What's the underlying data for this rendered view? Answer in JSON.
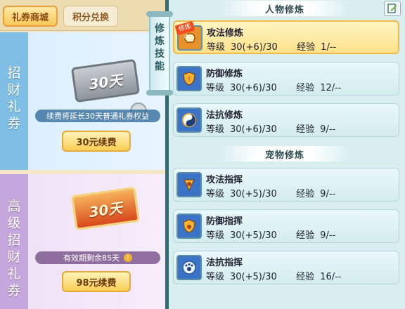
{
  "tabs": [
    {
      "label": "礼券商城",
      "active": true
    },
    {
      "label": "积分兑换",
      "active": false
    }
  ],
  "cards": [
    {
      "side_label": [
        "招",
        "财",
        "礼",
        "券"
      ],
      "ticket_text": "30天",
      "note": "续费将延长30天普通礼券权益",
      "button": "30元续费"
    },
    {
      "side_label": [
        "高",
        "级",
        "招",
        "财",
        "礼",
        "券"
      ],
      "ticket_text": "30天",
      "note": "有效期剩余85天",
      "info_icon": "i",
      "button": "98元续费"
    }
  ],
  "side_tab": [
    "修",
    "炼",
    "技",
    "能"
  ],
  "sections": {
    "character": "人物修炼",
    "pet": "宠物修炼"
  },
  "skills": [
    {
      "name": "攻法修炼",
      "level_label": "等级",
      "level": "30(+6)/30",
      "exp_label": "经验",
      "exp": "1/--",
      "badge": "修炼中",
      "icon": "fist-icon",
      "active": true
    },
    {
      "name": "防御修炼",
      "level_label": "等级",
      "level": "30(+6)/30",
      "exp_label": "经验",
      "exp": "12/--",
      "icon": "shield-icon"
    },
    {
      "name": "法抗修炼",
      "level_label": "等级",
      "level": "30(+6)/30",
      "exp_label": "经验",
      "exp": "9/--",
      "icon": "yinyang-icon"
    },
    {
      "name": "攻法指挥",
      "level_label": "等级",
      "level": "30(+5)/30",
      "exp_label": "经验",
      "exp": "9/--",
      "icon": "paw-attack-icon"
    },
    {
      "name": "防御指挥",
      "level_label": "等级",
      "level": "30(+5)/30",
      "exp_label": "经验",
      "exp": "9/--",
      "icon": "paw-shield-icon"
    },
    {
      "name": "法抗指挥",
      "level_label": "等级",
      "level": "30(+5)/30",
      "exp_label": "经验",
      "exp": "16/--",
      "icon": "paw-magic-icon"
    }
  ],
  "colors": {
    "accent": "#f8cf57",
    "active_row": "#fde28a",
    "panel_bg": "#d8eef0"
  }
}
